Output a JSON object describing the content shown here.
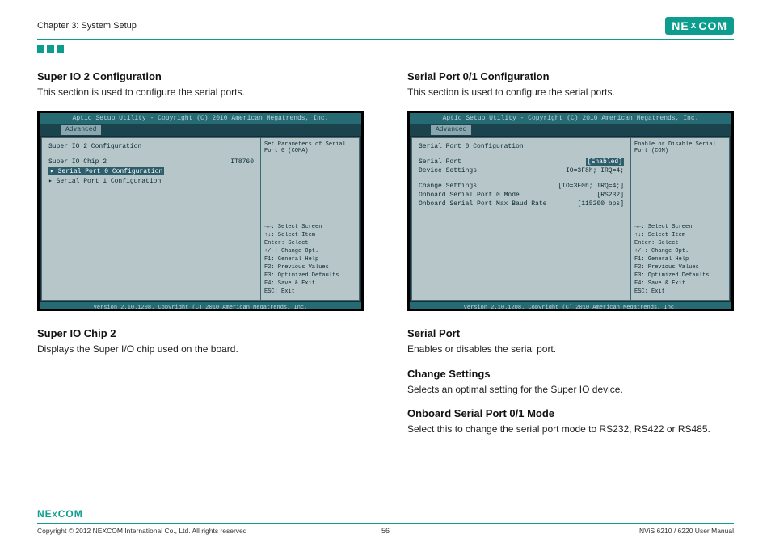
{
  "header": {
    "chapter": "Chapter 3: System Setup",
    "logo_left": "NE",
    "logo_x": "X",
    "logo_right": "COM"
  },
  "left": {
    "title1": "Super IO 2 Configuration",
    "desc1": "This section is used to configure the serial ports.",
    "title2": "Super IO Chip 2",
    "desc2": "Displays the Super I/O chip used on the board."
  },
  "right": {
    "title1": "Serial Port 0/1 Configuration",
    "desc1": "This section is used to configure the serial ports.",
    "title2": "Serial Port",
    "desc2": "Enables or disables the serial port.",
    "title3": "Change Settings",
    "desc3": "Selects an optimal setting for the Super IO device.",
    "title4": "Onboard Serial Port 0/1 Mode",
    "desc4": "Select this to change the serial port mode to RS232, RS422 or RS485."
  },
  "bios_shared": {
    "bar": "Aptio Setup Utility - Copyright (C) 2010 American Megatrends, Inc.",
    "tab": "Advanced",
    "nav1": "→←: Select Screen",
    "nav2": "↑↓: Select Item",
    "nav3": "Enter: Select",
    "nav4": "+/-: Change Opt.",
    "nav5": "F1: General Help",
    "nav6": "F2: Previous Values",
    "nav7": "F3: Optimized Defaults",
    "nav8": "F4: Save & Exit",
    "nav9": "ESC: Exit",
    "footer": "Version 2.10.1208. Copyright (C) 2010 American Megatrends, Inc."
  },
  "bios_left": {
    "heading": "Super IO 2 Configuration",
    "r1_label": "Super IO Chip 2",
    "r1_val": "IT8760",
    "r2": "▸ Serial Port 0 Configuration",
    "r3": "▸ Serial Port 1 Configuration",
    "help": "Set Parameters of Serial Port 0 (COMA)"
  },
  "bios_right": {
    "heading": "Serial Port 0 Configuration",
    "r1_label": "Serial Port",
    "r1_val": "[Enabled]",
    "r2_label": "Device Settings",
    "r2_val": "IO=3F8h; IRQ=4;",
    "r3_label": "Change Settings",
    "r3_val": "[IO=3F0h; IRQ=4;]",
    "r4_label": "Onboard Serial Port 0 Mode",
    "r4_val": "[RS232]",
    "r5_label": "Onboard Serial Port Max Baud Rate",
    "r5_val": "[115200  bps]",
    "help": "Enable or Disable Serial Port (COM)"
  },
  "footer": {
    "copyright": "Copyright © 2012 NEXCOM International Co., Ltd. All rights reserved",
    "page": "56",
    "manual": "NViS 6210 / 6220 User Manual"
  }
}
